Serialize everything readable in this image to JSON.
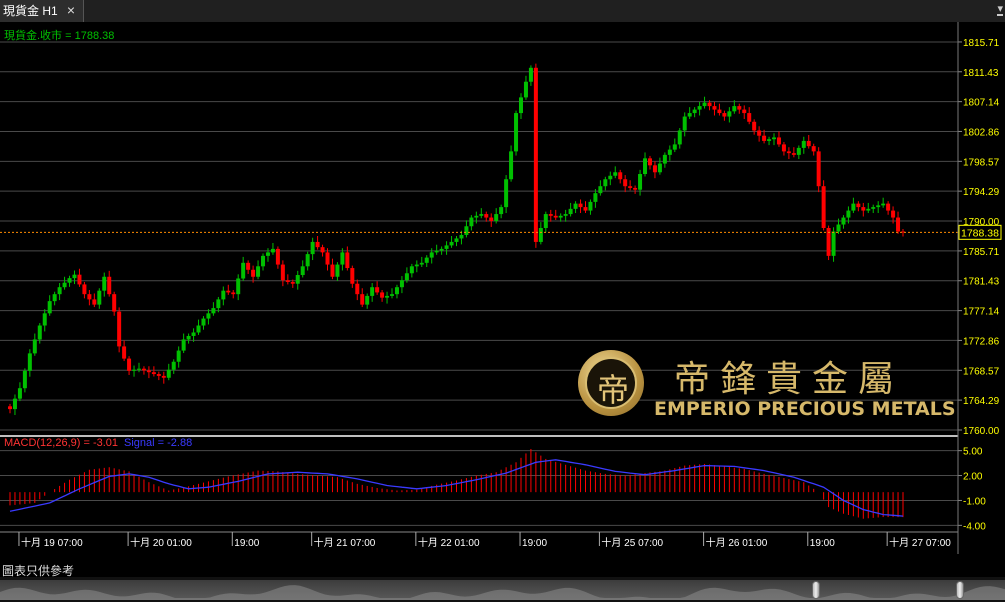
{
  "window": {
    "tab_title": "現貨金 H1",
    "close_glyph": "×"
  },
  "disclaimer": "圖表只供參考",
  "watermark": {
    "chinese": "帝鋒貴金屬",
    "english": "EMPERIO PRECIOUS METALS",
    "logo_glyph": "帝"
  },
  "colors": {
    "background": "#000000",
    "grid": "#4a4a4a",
    "axis_text": "#ffff00",
    "bull": "#00c000",
    "bear": "#ff0000",
    "price_line": "#ff8c00",
    "macd_title": "#ff3333",
    "signal": "#3a3aff",
    "price_label": "#00c000"
  },
  "chart_data": [
    {
      "type": "candlestick",
      "name": "現貨金",
      "legend": "現貨金.收市 = 1788.38",
      "current_price": 1788.38,
      "current_price_label": "1788.38",
      "ylim": [
        1760.0,
        1818.0
      ],
      "grid": true,
      "yticks": [
        "1815.71",
        "1811.43",
        "1807.14",
        "1802.86",
        "1798.57",
        "1794.29",
        "1790.00",
        "1785.71",
        "1781.43",
        "1777.14",
        "1772.86",
        "1768.57",
        "1764.29",
        "1760.00"
      ],
      "xtick_labels": [
        "十月 19 07:00",
        "十月 20 01:00",
        "19:00",
        "十月 21 07:00",
        "十月 22 01:00",
        "19:00",
        "十月 25 07:00",
        "十月 26 01:00",
        "19:00",
        "十月 27 07:00"
      ],
      "close_waypoints": [
        [
          0,
          1763.0
        ],
        [
          2,
          1766.0
        ],
        [
          4,
          1771.0
        ],
        [
          6,
          1775.0
        ],
        [
          8,
          1778.5
        ],
        [
          10,
          1780.5
        ],
        [
          12,
          1781.8
        ],
        [
          13,
          1782.3
        ],
        [
          15,
          1779.5
        ],
        [
          17,
          1778.0
        ],
        [
          19,
          1782.0
        ],
        [
          21,
          1777.0
        ],
        [
          22,
          1772.0
        ],
        [
          24,
          1768.5
        ],
        [
          26,
          1768.8
        ],
        [
          28,
          1768.3
        ],
        [
          31,
          1767.5
        ],
        [
          33,
          1769.8
        ],
        [
          35,
          1773.0
        ],
        [
          37,
          1774.0
        ],
        [
          39,
          1776.0
        ],
        [
          41,
          1777.5
        ],
        [
          43,
          1780.0
        ],
        [
          45,
          1779.5
        ],
        [
          47,
          1784.0
        ],
        [
          49,
          1782.0
        ],
        [
          51,
          1785.0
        ],
        [
          53,
          1786.0
        ],
        [
          55,
          1781.5
        ],
        [
          57,
          1781.0
        ],
        [
          59,
          1783.5
        ],
        [
          61,
          1787.0
        ],
        [
          63,
          1785.5
        ],
        [
          65,
          1782.0
        ],
        [
          67,
          1785.5
        ],
        [
          69,
          1781.0
        ],
        [
          71,
          1778.0
        ],
        [
          73,
          1780.5
        ],
        [
          75,
          1779.0
        ],
        [
          77,
          1779.5
        ],
        [
          79,
          1781.5
        ],
        [
          81,
          1783.5
        ],
        [
          83,
          1784.0
        ],
        [
          85,
          1785.5
        ],
        [
          87,
          1786.0
        ],
        [
          89,
          1787.0
        ],
        [
          91,
          1788.0
        ],
        [
          93,
          1790.5
        ],
        [
          95,
          1791.0
        ],
        [
          97,
          1790.0
        ],
        [
          99,
          1792.0
        ],
        [
          101,
          1800.0
        ],
        [
          102,
          1805.5
        ],
        [
          104,
          1810.0
        ],
        [
          105,
          1812.0
        ],
        [
          106,
          1787.0
        ],
        [
          108,
          1791.0
        ],
        [
          110,
          1790.5
        ],
        [
          112,
          1791.0
        ],
        [
          114,
          1792.5
        ],
        [
          116,
          1791.5
        ],
        [
          118,
          1794.0
        ],
        [
          120,
          1796.0
        ],
        [
          122,
          1797.0
        ],
        [
          124,
          1795.0
        ],
        [
          126,
          1794.5
        ],
        [
          128,
          1799.0
        ],
        [
          130,
          1797.0
        ],
        [
          132,
          1799.5
        ],
        [
          134,
          1801.0
        ],
        [
          136,
          1805.0
        ],
        [
          138,
          1806.0
        ],
        [
          140,
          1807.0
        ],
        [
          142,
          1806.0
        ],
        [
          144,
          1805.0
        ],
        [
          146,
          1806.5
        ],
        [
          148,
          1805.5
        ],
        [
          150,
          1803.0
        ],
        [
          152,
          1801.5
        ],
        [
          154,
          1802.0
        ],
        [
          156,
          1800.0
        ],
        [
          158,
          1799.5
        ],
        [
          160,
          1801.5
        ],
        [
          162,
          1800.0
        ],
        [
          163,
          1795.0
        ],
        [
          164,
          1789.0
        ],
        [
          165,
          1785.0
        ],
        [
          166,
          1788.5
        ],
        [
          168,
          1790.5
        ],
        [
          170,
          1792.5
        ],
        [
          172,
          1791.5
        ],
        [
          174,
          1792.0
        ],
        [
          176,
          1792.5
        ],
        [
          178,
          1790.5
        ],
        [
          179,
          1788.5
        ],
        [
          180,
          1788.38
        ]
      ],
      "candle_count": 181
    },
    {
      "type": "macd",
      "legend_macd": "MACD(12,26,9) = -3.01",
      "legend_signal": "Signal = -2.88",
      "ylim": [
        -4.8,
        5.8
      ],
      "yticks": [
        "5.00",
        "2.00",
        "-1.00",
        "-4.00"
      ],
      "macd_waypoints": [
        [
          0,
          -1.6
        ],
        [
          5,
          -1.3
        ],
        [
          8,
          0.0
        ],
        [
          12,
          1.5
        ],
        [
          16,
          2.7
        ],
        [
          20,
          3.0
        ],
        [
          24,
          2.5
        ],
        [
          28,
          1.2
        ],
        [
          32,
          0.2
        ],
        [
          36,
          0.7
        ],
        [
          40,
          1.3
        ],
        [
          44,
          1.9
        ],
        [
          50,
          2.6
        ],
        [
          54,
          2.5
        ],
        [
          58,
          2.2
        ],
        [
          62,
          2.0
        ],
        [
          66,
          1.8
        ],
        [
          70,
          1.0
        ],
        [
          74,
          0.5
        ],
        [
          78,
          0.2
        ],
        [
          82,
          0.3
        ],
        [
          86,
          0.9
        ],
        [
          90,
          1.4
        ],
        [
          94,
          2.0
        ],
        [
          98,
          2.4
        ],
        [
          102,
          3.6
        ],
        [
          105,
          5.2
        ],
        [
          108,
          4.0
        ],
        [
          112,
          3.3
        ],
        [
          116,
          2.6
        ],
        [
          120,
          2.2
        ],
        [
          124,
          2.0
        ],
        [
          128,
          2.3
        ],
        [
          132,
          2.6
        ],
        [
          136,
          3.2
        ],
        [
          140,
          3.4
        ],
        [
          144,
          3.1
        ],
        [
          148,
          2.8
        ],
        [
          152,
          2.2
        ],
        [
          156,
          1.7
        ],
        [
          160,
          1.2
        ],
        [
          163,
          0.0
        ],
        [
          165,
          -1.8
        ],
        [
          168,
          -2.6
        ],
        [
          172,
          -3.2
        ],
        [
          176,
          -3.0
        ],
        [
          180,
          -3.01
        ]
      ],
      "signal_waypoints": [
        [
          0,
          -2.3
        ],
        [
          8,
          -1.3
        ],
        [
          14,
          0.4
        ],
        [
          20,
          1.9
        ],
        [
          24,
          2.2
        ],
        [
          28,
          1.8
        ],
        [
          32,
          1.0
        ],
        [
          36,
          0.4
        ],
        [
          40,
          0.6
        ],
        [
          46,
          1.3
        ],
        [
          52,
          2.2
        ],
        [
          58,
          2.4
        ],
        [
          64,
          2.2
        ],
        [
          70,
          1.6
        ],
        [
          76,
          0.8
        ],
        [
          82,
          0.4
        ],
        [
          88,
          0.8
        ],
        [
          94,
          1.5
        ],
        [
          100,
          2.3
        ],
        [
          106,
          3.6
        ],
        [
          110,
          3.9
        ],
        [
          116,
          3.3
        ],
        [
          122,
          2.5
        ],
        [
          128,
          2.1
        ],
        [
          134,
          2.6
        ],
        [
          140,
          3.2
        ],
        [
          146,
          3.1
        ],
        [
          152,
          2.6
        ],
        [
          158,
          1.8
        ],
        [
          164,
          0.6
        ],
        [
          168,
          -1.0
        ],
        [
          172,
          -2.1
        ],
        [
          176,
          -2.7
        ],
        [
          180,
          -2.88
        ]
      ]
    }
  ]
}
